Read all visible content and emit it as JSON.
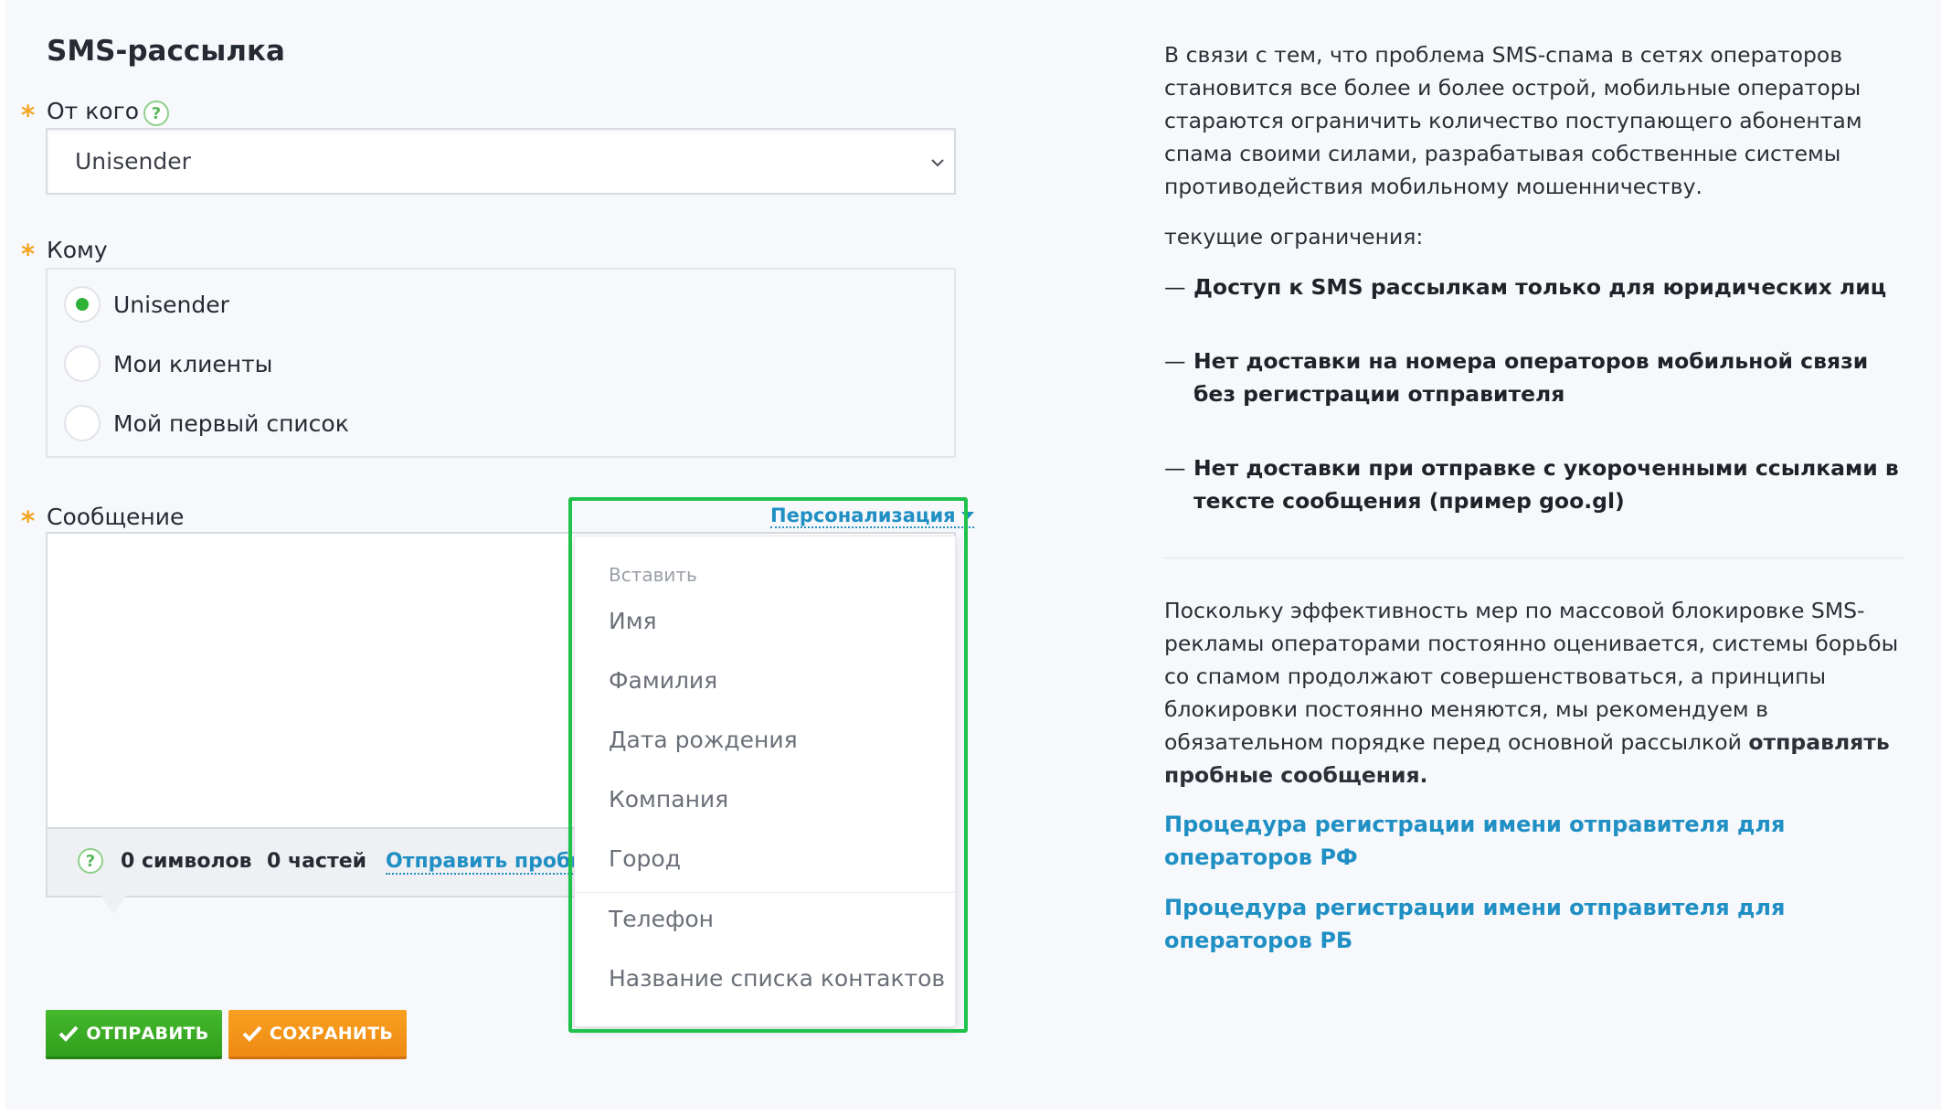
{
  "form": {
    "title": "SMS-рассылка",
    "required_marker": "*",
    "from": {
      "label": "От кого",
      "help": "?",
      "selected": "Unisender"
    },
    "to": {
      "label": "Кому",
      "options": [
        {
          "label": "Unisender",
          "checked": true
        },
        {
          "label": "Мои клиенты",
          "checked": false
        },
        {
          "label": "Мой первый список",
          "checked": false
        }
      ]
    },
    "message": {
      "label": "Сообщение",
      "value": "",
      "help": "?",
      "chars": "0 символов",
      "parts": "0 частей",
      "send_test_link": "Отправить пробное"
    },
    "buttons": {
      "send": "ОТПРАВИТЬ",
      "save": "СОХРАНИТЬ"
    }
  },
  "personalization": {
    "trigger": "Персонализация",
    "header": "Вставить",
    "items": [
      "Имя",
      "Фамилия",
      "Дата рождения",
      "Компания",
      "Город",
      "Телефон",
      "Название списка контактов"
    ]
  },
  "info": {
    "intro": "В связи с тем, что проблема SMS-спама в сетях операторов становится все более и более острой, мобильные операторы стараются ограничить количество поступающего абонентам спама своими силами, разрабатывая собственные системы противодействия мобильному мошенничеству.",
    "limits_heading": "текущие ограничения:",
    "limits": [
      "Доступ к SMS рассылкам только для юридических лиц",
      "Нет доставки на номера операторов мобильной связи без регистрации отправителя",
      "Нет доставки при отправке с укороченными ссылками в тексте сообщения (пример goo.gl)"
    ],
    "dash": "—",
    "recommendation_text": "Поскольку эффективность мер по массовой блокировке SMS-рекламы операторами постоянно оценивается, системы борьбы со спамом продолжают совершенствоваться, а принципы блокировки постоянно меняются, мы рекомендуем в обязательном порядке перед основной рассылкой",
    "recommendation_bold": "отправлять пробные сообщения.",
    "links": [
      "Процедура регистрации имени отправителя для операторов РФ",
      "Процедура регистрации имени отправителя для операторов РБ"
    ]
  },
  "colors": {
    "accent_green": "#2fb036",
    "accent_orange": "#ef8a12",
    "link_blue": "#1f8fc4",
    "highlight_green": "#1fc24a",
    "required_star": "#f5a623"
  }
}
